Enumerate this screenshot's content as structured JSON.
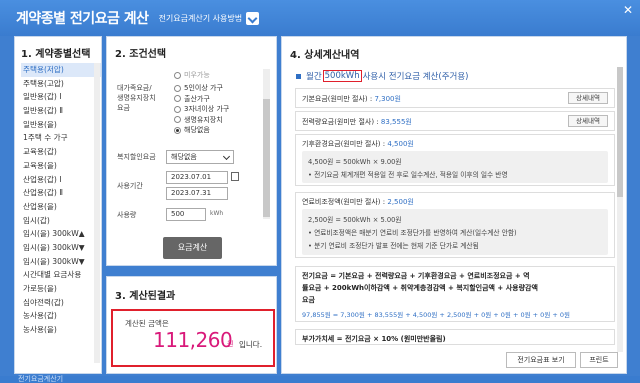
{
  "window": {
    "title": "계약종별 전기요금 계산",
    "guide_link": "전기요금계산기 사용방법"
  },
  "panel1": {
    "title": "1. 계약종별선택",
    "items": [
      "주택용(저압)",
      "주택용(고압)",
      "일반용(갑) Ⅰ",
      "일반용(갑) Ⅱ",
      "일반용(을)",
      "1주택 수 가구",
      "교육용(갑)",
      "교육용(을)",
      "산업용(갑) Ⅰ",
      "산업용(갑) Ⅱ",
      "산업용(을)",
      "임시(갑)",
      "임시(을) 300kW▲",
      "임시(을) 300kW▼",
      "임시(을) 300kW▼",
      "시간대별 요금사용",
      "가로등(을)",
      "심야전력(갑)",
      "농사용(갑)",
      "농사용(을)"
    ],
    "selected_index": 0
  },
  "panel2": {
    "title": "2. 조건선택",
    "family_label_1": "대가족요금/",
    "family_label_2": "생명유지장치",
    "family_label_3": "요금",
    "top_cut_option": "미우가능",
    "radio_options": [
      "5인이상 가구",
      "출산가구",
      "3자녀이상 가구",
      "생명유지장치",
      "해당없음"
    ],
    "radio_selected": 4,
    "welfare_label": "복지할인요금",
    "welfare_value": "해당없음",
    "period_label": "사용기간",
    "date_from": "2023.07.01",
    "date_to": "2023.07.31",
    "usage_label": "사용량",
    "usage_value": "500",
    "usage_unit": "kWh",
    "calc_button": "요금계산"
  },
  "panel3": {
    "title": "3. 계산된결과",
    "label": "계산된 금액은",
    "amount": "111,260",
    "currency": "원",
    "tail": "입니다."
  },
  "panel4": {
    "title": "4. 상세계산내역",
    "summary_prefix": "월간",
    "summary_highlight": "500kWh",
    "summary_suffix": "사용시 전기요금 계산(주거용)",
    "base_fee_label": "기본요금(원미만 절사) :",
    "base_fee_value": "7,300원",
    "energy_fee_label": "전력량요금(원미만 절사) :",
    "energy_fee_value": "83,555원",
    "detail_button": "상세내역",
    "climate_label": "기후환경요금(원미만 절사) :",
    "climate_value": "4,500원",
    "climate_line1": "4,500원 = 500kWh × 9.00원",
    "climate_line2": "• 전기요금 체계개편 적용일 전 후로 일수계산, 적용일 이후의 일수 반영",
    "fuel_label": "연료비조정액(원미만 절사) :",
    "fuel_value": "2,500원",
    "fuel_line1": "2,500원 = 500kWh × 5.00원",
    "fuel_line2": "• 연료비조정액은 매분기 연료비 조정단가를 반영하여 계산(일수계산 안함)",
    "fuel_line3": "• 분기 연료비 조정단가 발표 전에는 현재 기준 단가로 계산됨",
    "total_line1": "전기요금 = 기본요금 + 전력량요금 + 기후환경요금 + 연료비조정요금 + 역",
    "total_line2": "률요금 + 200kWh이하감액 + 취약계층경감액 + 복지할인금액 + 사용량감액",
    "total_line3": "요금",
    "total_values": "97,855원 = 7,300원 + 83,555원 + 4,500원 + 2,500원 + 0원 + 0원 + 0원 + 0원 + 0원",
    "vat_line": "부가가치세 = 전기요금 × 10% (원미만반올림)",
    "table_button": "전기요금표 보기",
    "print_button": "프린트"
  },
  "bottom_text": "전기요금계산기"
}
